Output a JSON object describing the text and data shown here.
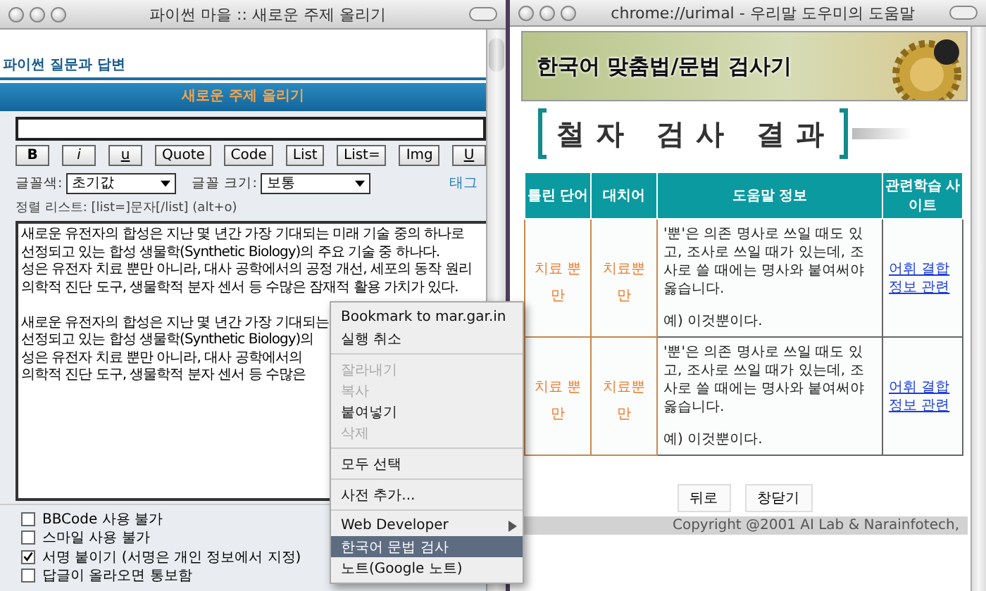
{
  "left_window": {
    "title": "파이썬 마을 :: 새로운 주제 올리기",
    "board_link": "파이썬 질문과 답변",
    "form_title": "새로운 주제 올리기",
    "format_buttons": [
      {
        "label": "B",
        "kind": "bold"
      },
      {
        "label": "i",
        "kind": "italic"
      },
      {
        "label": "u",
        "kind": "underline"
      },
      {
        "label": "Quote",
        "kind": "plain"
      },
      {
        "label": "Code",
        "kind": "plain"
      },
      {
        "label": "List",
        "kind": "plain"
      },
      {
        "label": "List=",
        "kind": "plain"
      },
      {
        "label": "Img",
        "kind": "plain"
      },
      {
        "label": "U",
        "kind": "underline"
      }
    ],
    "font_color": {
      "label": "글꼴색:",
      "value": "초기값"
    },
    "font_size": {
      "label": "글꼴 크기:",
      "value": "보통"
    },
    "tag_link": "태그",
    "hint": "정렬 리스트: [list=]문자[/list]  (alt+o)",
    "body_paragraphs": [
      [
        "새로운 유전자의 합성은 지난 몇 년간 가장 기대되는 미래 기술 중의 하나로",
        "선정되고 있는 합성 생물학(Synthetic Biology)의 주요 기술 중 하나다.",
        "성은 유전자 치료 뿐만 아니라, 대사 공학에서의 공정 개선, 세포의 동작 원리",
        "의학적 진단 도구, 생물학적 분자 센서 등 수많은 잠재적 활용 가치가 있다."
      ],
      [
        "새로운 유전자의 합성은 지난 몇 년간 가장 기대되는",
        "선정되고 있는 합성 생물학(Synthetic Biology)의",
        "성은 유전자 치료 뿐만 아니라, 대사 공학에서의",
        "의학적 진단 도구, 생물학적 분자 센서 등 수많은"
      ]
    ],
    "options": [
      {
        "label": "BBCode 사용 불가",
        "checked": false
      },
      {
        "label": "스마일 사용 불가",
        "checked": false
      },
      {
        "label": "서명 붙이기 (서명은 개인 정보에서 지정)",
        "checked": true
      },
      {
        "label": "답글이 올라오면 통보함",
        "checked": false
      }
    ]
  },
  "context_menu": {
    "items": [
      {
        "kind": "item",
        "label": "Bookmark to mar.gar.in",
        "disabled": false,
        "selected": false
      },
      {
        "kind": "item",
        "label": "실행 취소",
        "disabled": false,
        "selected": false
      },
      {
        "kind": "separator"
      },
      {
        "kind": "item",
        "label": "잘라내기",
        "disabled": true,
        "selected": false
      },
      {
        "kind": "item",
        "label": "복사",
        "disabled": true,
        "selected": false
      },
      {
        "kind": "item",
        "label": "붙여넣기",
        "disabled": false,
        "selected": false
      },
      {
        "kind": "item",
        "label": "삭제",
        "disabled": true,
        "selected": false
      },
      {
        "kind": "separator"
      },
      {
        "kind": "item",
        "label": "모두 선택",
        "disabled": false,
        "selected": false
      },
      {
        "kind": "separator"
      },
      {
        "kind": "item",
        "label": "사전 추가...",
        "disabled": false,
        "selected": false
      },
      {
        "kind": "separator"
      },
      {
        "kind": "submenu",
        "label": "Web Developer",
        "disabled": false,
        "selected": false
      },
      {
        "kind": "item",
        "label": "한국어 문법 검사",
        "disabled": false,
        "selected": true
      },
      {
        "kind": "item",
        "label": "노트(Google 노트)",
        "disabled": false,
        "selected": false
      }
    ]
  },
  "right_window": {
    "title": "chrome://urimal - 우리말 도우미의 도움말",
    "banner_title": "한국어 맞춤법/문법 검사기",
    "section_title": "철자 검사 결과",
    "table": {
      "columns": [
        "틀린 단어",
        "대치어",
        "도움말 정보",
        "관련학습 사이트"
      ],
      "rows": [
        {
          "wrong_word": "치료 뿐만",
          "replacement": "치료뿐만",
          "help": "'뿐'은 의존 명사로 쓰일 때도 있고, 조사로 쓰일 때가 있는데, 조사로 쓸 때에는 명사와 붙여써야 옳습니다.",
          "example": "예) 이것뿐이다.",
          "link": "어휘 결합 정보 관련"
        },
        {
          "wrong_word": "치료 뿐만",
          "replacement": "치료뿐만",
          "help": "'뿐'은 의존 명사로 쓰일 때도 있고, 조사로 쓰일 때가 있는데, 조사로 쓸 때에는 명사와 붙여써야 옳습니다.",
          "example": "예) 이것뿐이다.",
          "link": "어휘 결합 정보 관련"
        }
      ]
    },
    "buttons": [
      "뒤로",
      "창닫기"
    ],
    "copyright": "Copyright @2001 AI Lab & Narainfotech,"
  }
}
